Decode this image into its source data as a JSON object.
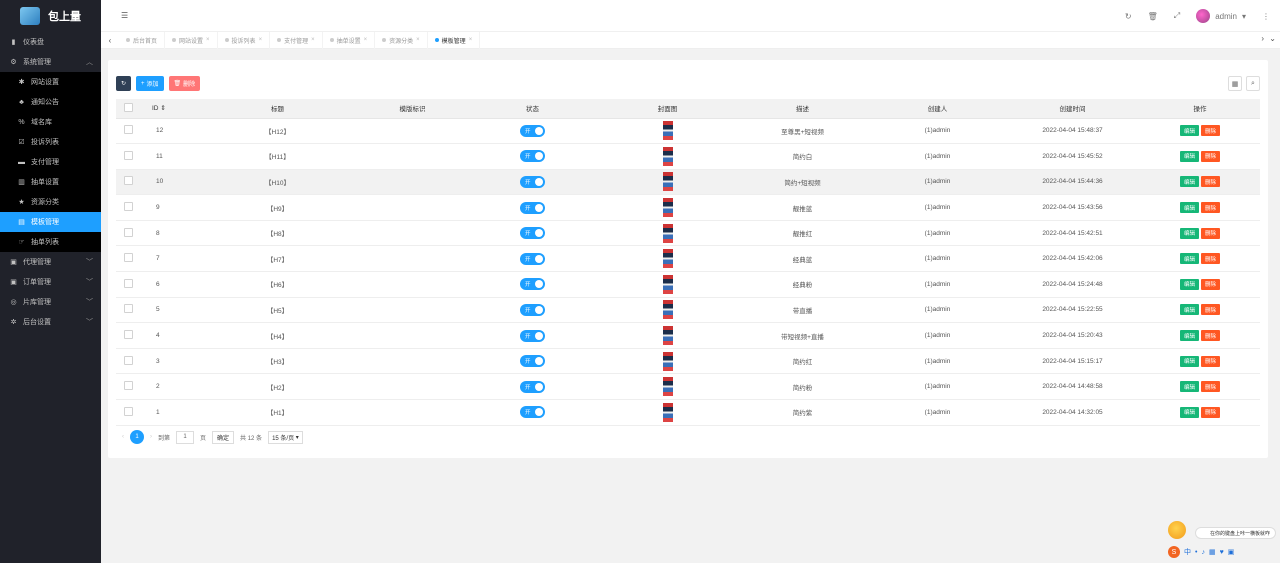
{
  "app": {
    "title": "包上量"
  },
  "topbar": {
    "user": "admin"
  },
  "sidebar": {
    "items": [
      {
        "label": "仪表盘"
      },
      {
        "label": "系统管理"
      },
      {
        "label": "网站设置"
      },
      {
        "label": "通知公告"
      },
      {
        "label": "域名库"
      },
      {
        "label": "投诉列表"
      },
      {
        "label": "支付管理"
      },
      {
        "label": "抽单设置"
      },
      {
        "label": "资源分类"
      },
      {
        "label": "模板管理"
      },
      {
        "label": "抽单列表"
      },
      {
        "label": "代理管理"
      },
      {
        "label": "订单管理"
      },
      {
        "label": "片库管理"
      },
      {
        "label": "后台设置"
      }
    ]
  },
  "tabs": [
    {
      "label": "后台首页"
    },
    {
      "label": "网站设置"
    },
    {
      "label": "投诉列表"
    },
    {
      "label": "支付管理"
    },
    {
      "label": "抽单设置"
    },
    {
      "label": "资源分类"
    },
    {
      "label": "模板管理"
    }
  ],
  "toolbar": {
    "add": "添加",
    "delete": "删除"
  },
  "table": {
    "headers": [
      "ID",
      "标题",
      "模版标识",
      "状态",
      "封面图",
      "描述",
      "创建人",
      "创建时间",
      "操作"
    ],
    "switch_label": "开",
    "edit_label": "编辑",
    "del_label": "删除",
    "rows": [
      {
        "id": "12",
        "title": "【H12】",
        "desc": "至尊黑+短视频",
        "creator": "(1)admin",
        "time": "2022-04-04 15:48:37"
      },
      {
        "id": "11",
        "title": "【H11】",
        "desc": "简约白",
        "creator": "(1)admin",
        "time": "2022-04-04 15:45:52"
      },
      {
        "id": "10",
        "title": "【H10】",
        "desc": "简约+短视频",
        "creator": "(1)admin",
        "time": "2022-04-04 15:44:36"
      },
      {
        "id": "9",
        "title": "【H9】",
        "desc": "靓推蓝",
        "creator": "(1)admin",
        "time": "2022-04-04 15:43:56"
      },
      {
        "id": "8",
        "title": "【H8】",
        "desc": "靓推红",
        "creator": "(1)admin",
        "time": "2022-04-04 15:42:51"
      },
      {
        "id": "7",
        "title": "【H7】",
        "desc": "经典蓝",
        "creator": "(1)admin",
        "time": "2022-04-04 15:42:06"
      },
      {
        "id": "6",
        "title": "【H6】",
        "desc": "经典粉",
        "creator": "(1)admin",
        "time": "2022-04-04 15:24:48"
      },
      {
        "id": "5",
        "title": "【H5】",
        "desc": "带直播",
        "creator": "(1)admin",
        "time": "2022-04-04 15:22:55"
      },
      {
        "id": "4",
        "title": "【H4】",
        "desc": "带短视频+直播",
        "creator": "(1)admin",
        "time": "2022-04-04 15:20:43"
      },
      {
        "id": "3",
        "title": "【H3】",
        "desc": "简约红",
        "creator": "(1)admin",
        "time": "2022-04-04 15:15:17"
      },
      {
        "id": "2",
        "title": "【H2】",
        "desc": "简约粉",
        "creator": "(1)admin",
        "time": "2022-04-04 14:48:58"
      },
      {
        "id": "1",
        "title": "【H1】",
        "desc": "简约紫",
        "creator": "(1)admin",
        "time": "2022-04-04 14:32:05"
      }
    ]
  },
  "pager": {
    "current": "1",
    "goto": "到第",
    "page_input": "1",
    "page_unit": "页",
    "ok": "确定",
    "total": "共 12 条",
    "per_page": "15 条/页"
  },
  "ime": {
    "tip": "在你的键盘上咔一横板就咋"
  },
  "colors": {
    "accent": "#1e9fff",
    "sidebar": "#20222a",
    "edit": "#16b777",
    "delete": "#ff5722"
  }
}
